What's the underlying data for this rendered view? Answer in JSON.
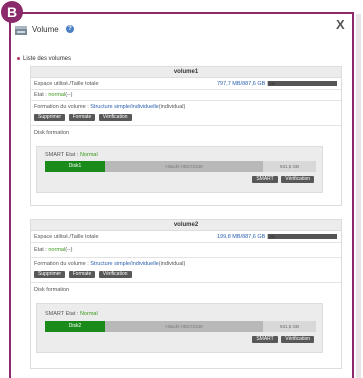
{
  "badge": "B",
  "header": {
    "title": "Volume",
    "help": "?",
    "close": "X"
  },
  "section_title": "Liste des volumes",
  "labels": {
    "capacity": "Espace utilisé./Taille totale",
    "state_prefix": "Etat :",
    "formation_prefix": "Formation du volume :",
    "disk_formation": "Disk formation",
    "smart_prefix": "SMART Etat :"
  },
  "buttons": {
    "delete": "Supprimer",
    "format": "Formate",
    "verify": "Vérification",
    "smart": "SMART"
  },
  "volumes": [
    {
      "name": "volume1",
      "capacity": "797,7 MB/887,6 GB",
      "capacity_pct": "1%",
      "capacity_fraction": 0.01,
      "state": "normal",
      "state_suffix": "(--)",
      "formation": "Structure simple/individuelle",
      "formation_suffix": "(individual)",
      "smart_state": "Normal",
      "disk": {
        "name": "Disk1",
        "model": "Hitachi HDS72100",
        "size": "931,5 GB"
      }
    },
    {
      "name": "volume2",
      "capacity": "199,8 MB/887,6 GB",
      "capacity_pct": "1%",
      "capacity_fraction": 0.01,
      "state": "normal",
      "state_suffix": "(--)",
      "formation": "Structure simple/individuelle",
      "formation_suffix": "(individual)",
      "smart_state": "Normal",
      "disk": {
        "name": "Disk2",
        "model": "Hitachi HDS72100",
        "size": "931,5 GB"
      }
    }
  ],
  "colors": {
    "accent": "#8b2a6b",
    "disk_green": "#1a8a1a",
    "status_green": "#3a9a1a",
    "link_blue": "#2a5fb0"
  }
}
